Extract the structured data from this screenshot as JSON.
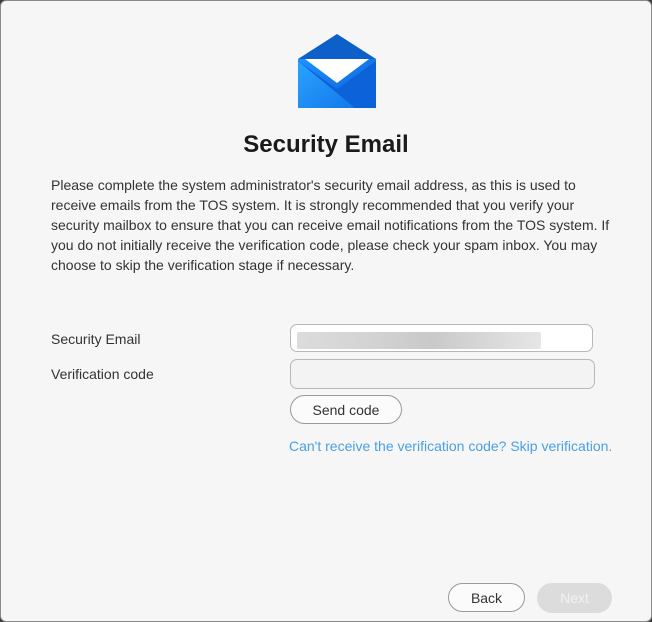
{
  "dialog": {
    "title": "Security Email",
    "description": "Please complete the system administrator's security email address, as this is used to receive emails from the TOS system. It is strongly recommended that you verify your security mailbox to ensure that you can receive email notifications from the TOS system. If you do not initially receive the verification code, please check your spam inbox. You may choose to skip the verification stage if necessary.",
    "icon": "mail-open-icon"
  },
  "form": {
    "email_label": "Security Email",
    "email_value": "",
    "code_label": "Verification code",
    "code_value": "",
    "send_code_label": "Send code",
    "skip_link": "Can't receive the verification code? Skip verification."
  },
  "footer": {
    "back_label": "Back",
    "next_label": "Next"
  },
  "colors": {
    "accent_link": "#4aa0e6",
    "icon_blue": "#1a73e8",
    "disabled_button": "#dcdcdc"
  }
}
